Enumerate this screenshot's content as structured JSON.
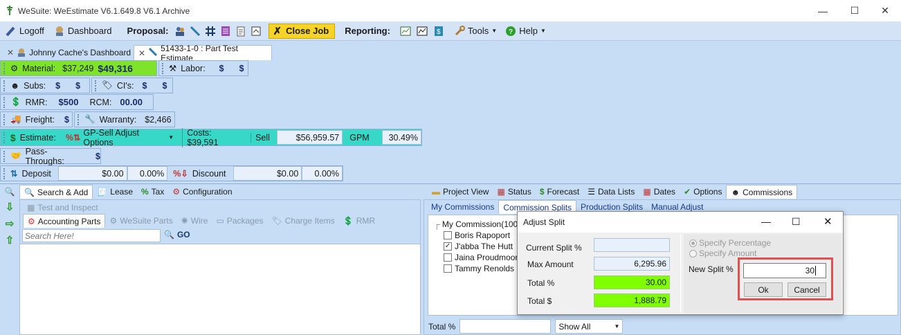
{
  "window": {
    "title": "WeSuite: WeEstimate V6.1.649.8 V6.1 Archive"
  },
  "toolbar": {
    "logoff": "Logoff",
    "dashboard": "Dashboard",
    "proposal": "Proposal:",
    "close_job": "Close Job",
    "reporting": "Reporting:",
    "tools": "Tools",
    "help": "Help"
  },
  "doc_tabs": [
    {
      "label": "Johnny Cache's Dashboard"
    },
    {
      "label": "51433-1-0 : Part Test Estimate"
    }
  ],
  "summary": {
    "material_label": "Material:",
    "material_cost": "$37,249",
    "material_sell": "$49,316",
    "labor_label": "Labor:",
    "labor_cost": "$",
    "labor_sell": "$",
    "subs_label": "Subs:",
    "subs_cost": "$",
    "subs_sell": "$",
    "cis_label": "CI's:",
    "cis_cost": "$",
    "cis_sell": "$",
    "rmr_label": "RMR:",
    "rmr_value": "$500",
    "rcm_label": "RCM:",
    "rcm_value": "00.00",
    "freight_label": "Freight:",
    "freight_value": "$",
    "warranty_label": "Warranty:",
    "warranty_value": "$2,466",
    "estimate_label": "Estimate:",
    "gp_sell_label": "GP-Sell Adjust Options",
    "costs_label": "Costs: $39,591",
    "sell_label": "Sell",
    "sell_value": "$56,959.57",
    "gpm_label": "GPM",
    "gpm_value": "30.49%",
    "pass_label": "Pass-Throughs:",
    "pass_value": "$",
    "deposit_label": "Deposit",
    "deposit_amount": "$0.00",
    "deposit_pct": "0.00%",
    "discount_label": "Discount",
    "discount_amount": "$0.00",
    "discount_pct": "0.00%"
  },
  "left": {
    "tabs": [
      "Search & Add",
      "Lease",
      "Tax",
      "Configuration"
    ],
    "subtab_test": "Test and Inspect",
    "subtabs": [
      "Accounting Parts",
      "WeSuite Parts",
      "Wire",
      "Packages",
      "Charge Items",
      "RMR"
    ],
    "search_placeholder": "Search Here!",
    "go": "GO"
  },
  "right": {
    "tabs": [
      "Project View",
      "Status",
      "Forecast",
      "Data Lists",
      "Dates",
      "Options",
      "Commissions"
    ],
    "subtabs": [
      "My Commissions",
      "Commission Splits",
      "Production Splits",
      "Manual Adjust"
    ],
    "tree_root": "My Commission(100.",
    "people": [
      {
        "name": "Boris Rapoport",
        "checked": false
      },
      {
        "name": "J'abba The Hutt",
        "checked": true
      },
      {
        "name": "Jaina Proudmoore",
        "checked": false
      },
      {
        "name": "Tammy Renolds",
        "checked": false
      }
    ],
    "total_pct_label": "Total %",
    "show_all": "Show All"
  },
  "dialog": {
    "title": "Adjust Split",
    "current_split_label": "Current Split %",
    "current_split_value": "",
    "max_amount_label": "Max Amount",
    "max_amount_value": "6,295.96",
    "total_pct_label": "Total %",
    "total_pct_value": "30.00",
    "total_amt_label": "Total $",
    "total_amt_value": "1,888.79",
    "specify_pct": "Specify Percentage",
    "specify_amt": "Specify Amount",
    "new_split_label": "New Split %",
    "new_split_value": "30",
    "ok": "Ok",
    "cancel": "Cancel"
  }
}
